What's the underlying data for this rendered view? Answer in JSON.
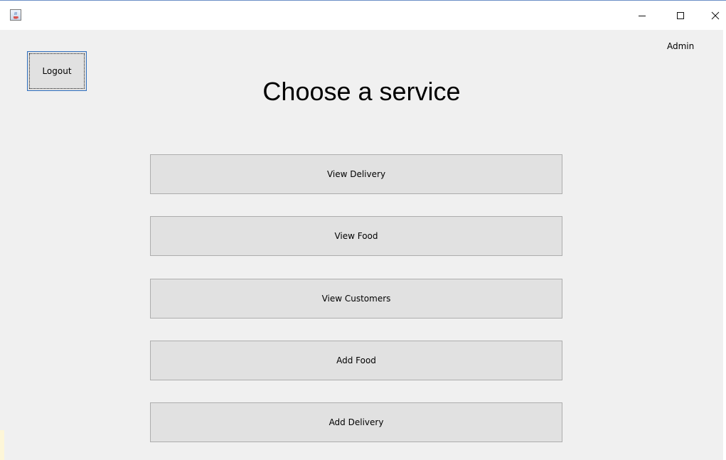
{
  "window": {
    "icon": "java-cup-icon",
    "controls": {
      "minimize": "minimize-icon",
      "maximize": "maximize-icon",
      "close": "close-icon"
    }
  },
  "header": {
    "logout_label": "Logout",
    "user_label": "Admin",
    "title": "Choose a service"
  },
  "services": [
    {
      "label": "View Delivery"
    },
    {
      "label": "View Food"
    },
    {
      "label": "View Customers"
    },
    {
      "label": "Add Food"
    },
    {
      "label": "Add Delivery"
    }
  ],
  "colors": {
    "panel_background": "#f0f0f0",
    "button_background": "#e1e1e1",
    "button_border": "#adadad",
    "focus_border": "#2f6fbf"
  }
}
